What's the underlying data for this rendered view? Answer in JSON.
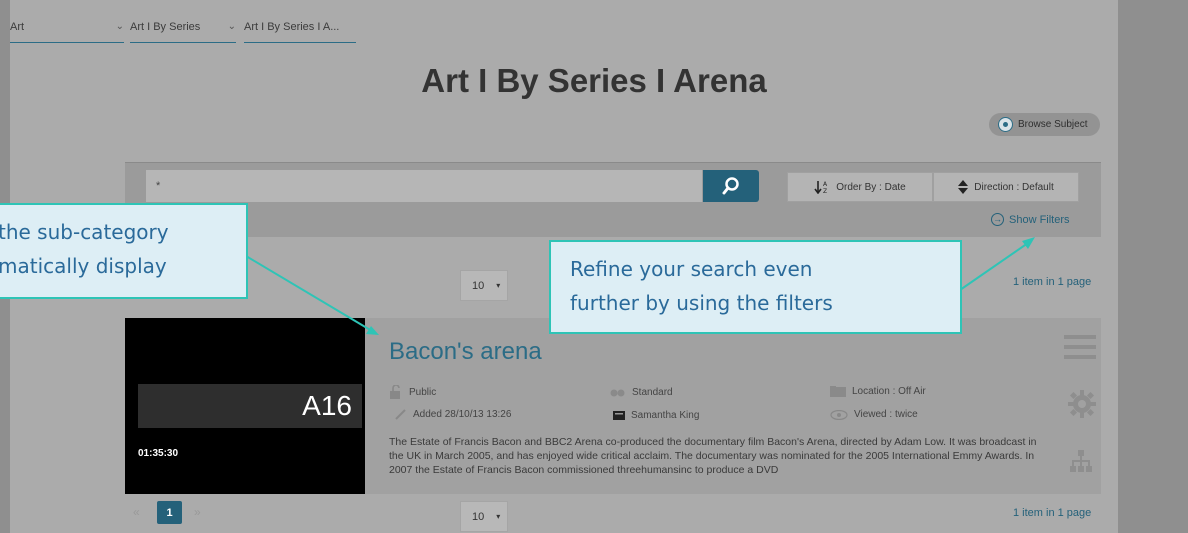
{
  "breadcrumb": [
    {
      "label": "Art"
    },
    {
      "label": "Art I By Series"
    },
    {
      "label": "Art I By Series I A..."
    }
  ],
  "page_title": "Art I By Series I Arena",
  "browse_subject": "Browse Subject",
  "search": {
    "value": "*"
  },
  "order_by": "Order By : Date",
  "direction": "Direction : Default",
  "show_filters": "Show Filters",
  "pager_top": {
    "per_page": "10",
    "count": "1 item in 1 page"
  },
  "result": {
    "thumb_code": "A16",
    "duration": "01:35:30",
    "title": "Bacon's arena",
    "visibility": "Public",
    "quality": "Standard",
    "location": "Location : Off Air",
    "added": "Added 28/10/13 13:26",
    "author": "Samantha King",
    "viewed": "Viewed : twice",
    "description": "The Estate of Francis Bacon and BBC2 Arena co-produced the documentary film Bacon's Arena, directed by Adam Low. It was broadcast in the UK in March 2005, and has enjoyed wide critical acclaim. The documentary was nominated for the 2005 International Emmy Awards. In 2007 the Estate of Francis Bacon commissioned threehumansinc to produce a DVD"
  },
  "pager_bottom": {
    "current_page": "1",
    "per_page": "10",
    "count": "1 item in 1 page"
  },
  "callouts": {
    "left_line1": "the sub-category",
    "left_line2": "matically display",
    "right_line1": "Refine your search even",
    "right_line2": "further by using the filters"
  },
  "colors": {
    "accent": "#24617a",
    "callout_border": "#2ec4b6",
    "callout_text": "#2a6a9a"
  }
}
